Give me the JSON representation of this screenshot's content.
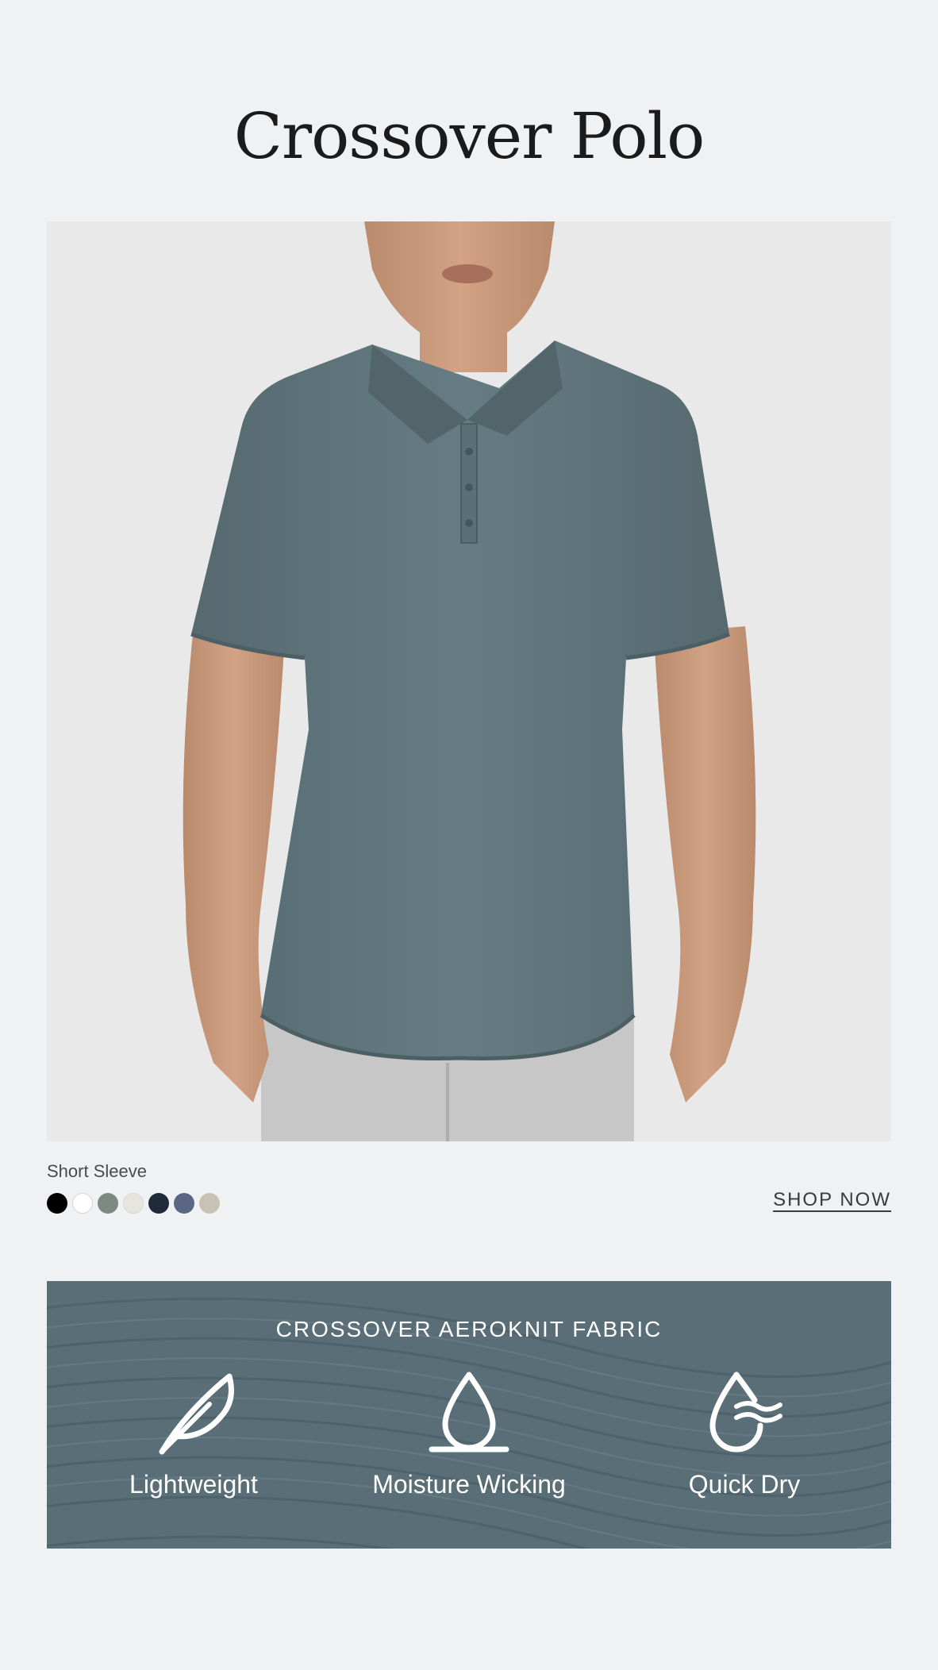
{
  "header": {
    "title": "Crossover Polo"
  },
  "product": {
    "variant_label": "Short Sleeve",
    "swatches": [
      {
        "name": "black",
        "color": "#000000"
      },
      {
        "name": "white",
        "color": "#ffffff"
      },
      {
        "name": "sage",
        "color": "#7d8a82"
      },
      {
        "name": "bone",
        "color": "#e7e6de"
      },
      {
        "name": "navy",
        "color": "#1f2a3a"
      },
      {
        "name": "slate-blue",
        "color": "#5b6685"
      },
      {
        "name": "stone",
        "color": "#c9c1b4"
      }
    ],
    "cta_label": "SHOP NOW"
  },
  "fabric": {
    "title": "CROSSOVER AEROKNIT FABRIC",
    "features": [
      {
        "label": "Lightweight",
        "icon": "feather-icon"
      },
      {
        "label": "Moisture Wicking",
        "icon": "water-drop-icon"
      },
      {
        "label": "Quick Dry",
        "icon": "drop-wind-icon"
      }
    ]
  },
  "colors": {
    "shirt": "#5d747d",
    "fabric_bg": "#5a6e77",
    "page_bg": "#f0f1f3"
  }
}
